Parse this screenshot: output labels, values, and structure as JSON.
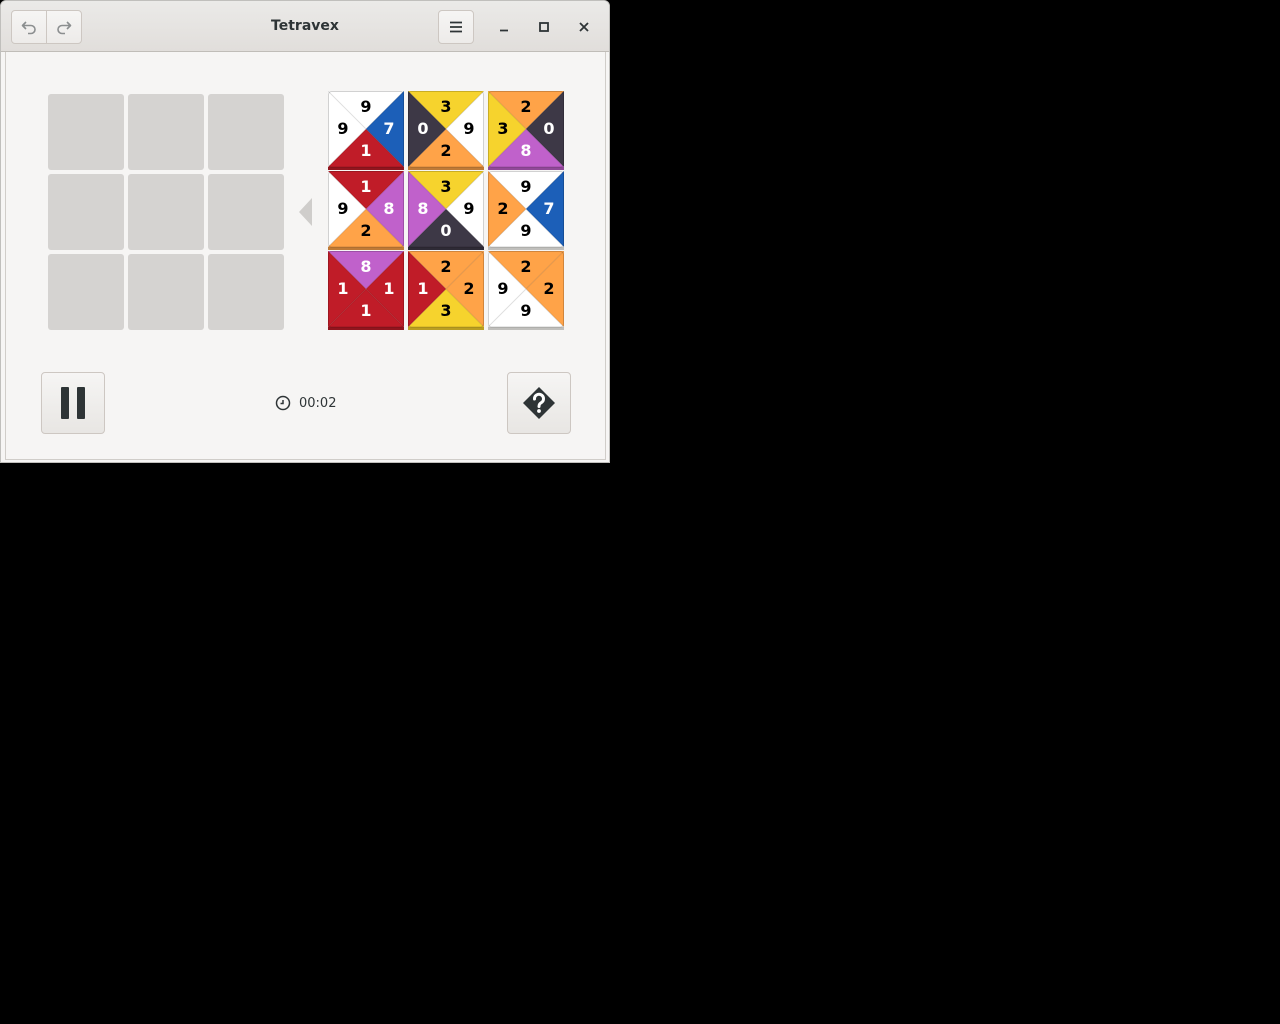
{
  "window": {
    "title": "Tetravex"
  },
  "headerbar": {
    "undo_icon": "undo-icon",
    "redo_icon": "redo-icon",
    "menu_icon": "hamburger-menu-icon",
    "minimize_icon": "minimize-icon",
    "maximize_icon": "maximize-icon",
    "close_icon": "close-icon"
  },
  "board": {
    "rows": 3,
    "cols": 3,
    "empty_slots": 9
  },
  "colors": {
    "0": "#3d3846",
    "1": "#c01c28",
    "2": "#ffa348",
    "3": "#f6d32d",
    "7": "#1c5fb8",
    "8": "#c061cb",
    "9": "#ffffff"
  },
  "tiles": [
    {
      "top": "9",
      "right": "7",
      "bottom": "1",
      "left": "9"
    },
    {
      "top": "3",
      "right": "9",
      "bottom": "2",
      "left": "0"
    },
    {
      "top": "2",
      "right": "0",
      "bottom": "8",
      "left": "3"
    },
    {
      "top": "1",
      "right": "8",
      "bottom": "2",
      "left": "9"
    },
    {
      "top": "3",
      "right": "9",
      "bottom": "0",
      "left": "8"
    },
    {
      "top": "9",
      "right": "7",
      "bottom": "9",
      "left": "2"
    },
    {
      "top": "8",
      "right": "1",
      "bottom": "1",
      "left": "1"
    },
    {
      "top": "2",
      "right": "2",
      "bottom": "3",
      "left": "1"
    },
    {
      "top": "2",
      "right": "2",
      "bottom": "9",
      "left": "9"
    }
  ],
  "footer": {
    "pause_icon": "pause-icon",
    "timer_icon": "clock-icon",
    "timer": "00:02",
    "solve_icon": "solve-hint-icon"
  }
}
